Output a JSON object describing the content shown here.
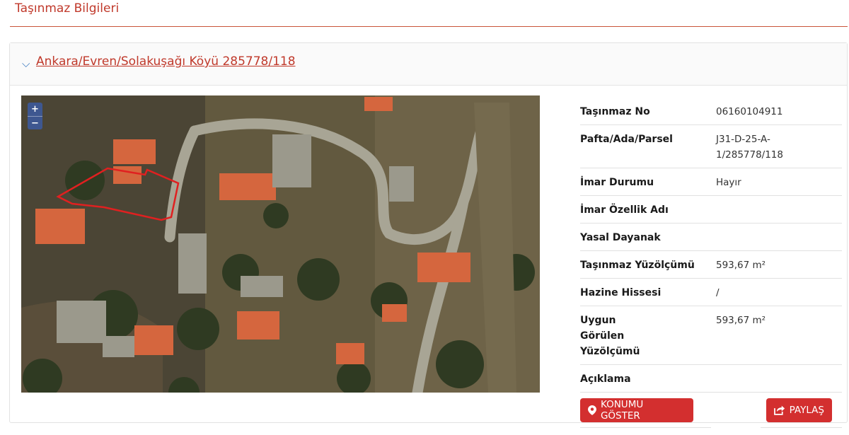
{
  "page": {
    "title": "Taşınmaz Bilgileri"
  },
  "parcel": {
    "link_text": "Ankara/Evren/Solakuşağı Köyü 285778/118",
    "toggle_icon": "chevron-down-icon"
  },
  "map": {
    "zoom_in": "+",
    "zoom_out": "−",
    "parcel_outline_color": "#e02020"
  },
  "details": [
    {
      "label": "Taşınmaz No",
      "value": "06160104911"
    },
    {
      "label": "Pafta/Ada/Parsel",
      "value": "J31-D-25-A-1/285778/118"
    },
    {
      "label": "İmar Durumu",
      "value": "Hayır"
    },
    {
      "label": "İmar Özellik Adı",
      "value": ""
    },
    {
      "label": "Yasal Dayanak",
      "value": ""
    },
    {
      "label": "Taşınmaz Yüzölçümü",
      "value": "593,67 m²"
    },
    {
      "label": "Hazine Hissesi",
      "value": "/"
    },
    {
      "label": "Uygun Görülen Yüzölçümü",
      "value": "593,67 m²"
    },
    {
      "label": "Açıklama",
      "value": ""
    }
  ],
  "actions": {
    "show_location": "KONUMU GÖSTER",
    "share": "PAYLAŞ",
    "accent": "#d32f2f"
  }
}
